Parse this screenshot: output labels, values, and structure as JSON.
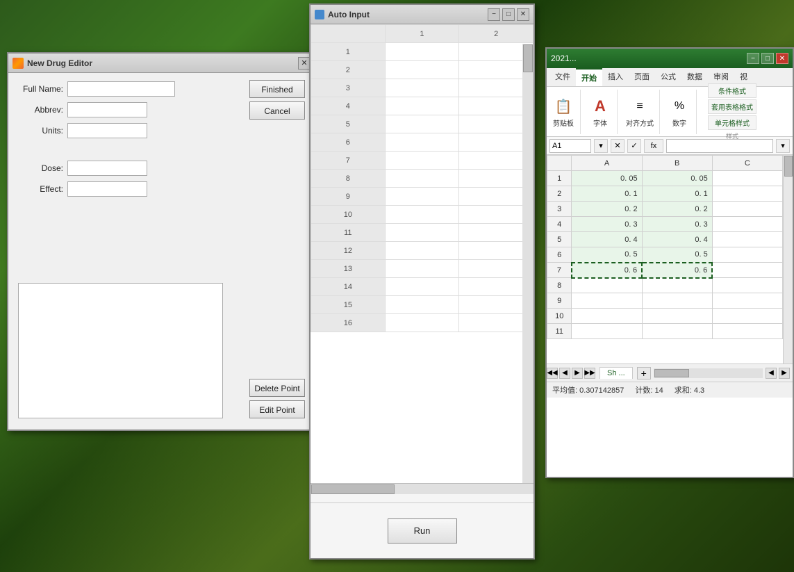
{
  "background": {
    "description": "Green leafy jungle background"
  },
  "drugEditor": {
    "title": "New Drug Editor",
    "labels": {
      "fullName": "Full Name:",
      "abbrev": "Abbrev:",
      "units": "Units:",
      "dose": "Dose:",
      "effect": "Effect:"
    },
    "buttons": {
      "finished": "Finished",
      "cancel": "Cancel",
      "deletePoint": "Delete Point",
      "editPoint": "Edit Point"
    },
    "inputs": {
      "fullName": "",
      "abbrev": "",
      "units": "",
      "dose": "",
      "effect": ""
    }
  },
  "autoInput": {
    "title": "Auto Input",
    "columnHeaders": [
      "1",
      "2"
    ],
    "rowNumbers": [
      "1",
      "2",
      "3",
      "4",
      "5",
      "6",
      "7",
      "8",
      "9",
      "10",
      "11",
      "12",
      "13",
      "14",
      "15",
      "16"
    ],
    "runButton": "Run"
  },
  "excel": {
    "title": "2021...",
    "ribbonTabs": [
      "文件",
      "开始",
      "插入",
      "页面",
      "公式",
      "数据",
      "审阅",
      "视"
    ],
    "activeTab": "开始",
    "ribbonGroups": [
      {
        "icon": "📋",
        "label": "剪贴板"
      },
      {
        "icon": "A",
        "label": "字体"
      },
      {
        "icon": "≡",
        "label": "对齐方式"
      },
      {
        "icon": "%",
        "label": "数字"
      }
    ],
    "sideButtons": [
      "条件格式",
      "套用表格格式",
      "单元格样式"
    ],
    "sectionLabel": "样式",
    "nameBox": "A1",
    "formulaBar": "",
    "columns": [
      "A",
      "B",
      "C"
    ],
    "rowNumbers": [
      "1",
      "2",
      "3",
      "4",
      "5",
      "6",
      "7",
      "8",
      "9",
      "10",
      "11"
    ],
    "data": [
      [
        "0. 05",
        "0. 05",
        ""
      ],
      [
        "0. 1",
        "0. 1",
        ""
      ],
      [
        "0. 2",
        "0. 2",
        ""
      ],
      [
        "0. 3",
        "0. 3",
        ""
      ],
      [
        "0. 4",
        "0. 4",
        ""
      ],
      [
        "0. 5",
        "0. 5",
        ""
      ],
      [
        "0. 6",
        "0. 6",
        ""
      ],
      [
        "",
        "",
        ""
      ],
      [
        "",
        "",
        ""
      ],
      [
        "",
        "",
        ""
      ],
      [
        "",
        "",
        ""
      ]
    ],
    "statusBar": {
      "average": "平均值: 0.307142857",
      "count": "计数: 14",
      "sum": "求和: 4.3"
    },
    "sheetTab": "Sh ...",
    "scrollbarBottom": true
  }
}
